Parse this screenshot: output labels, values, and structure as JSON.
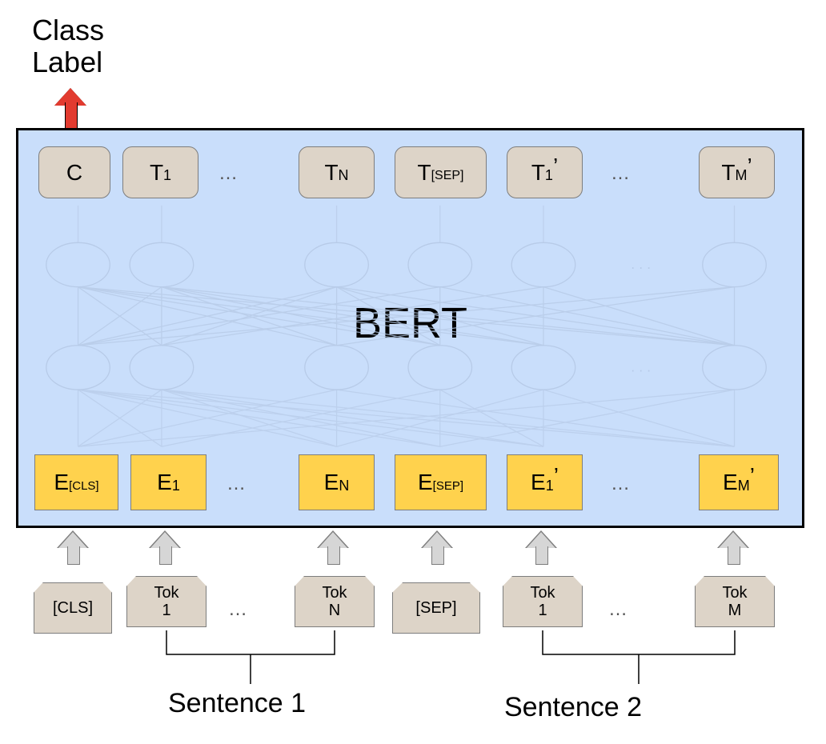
{
  "class_label_line1": "Class",
  "class_label_line2": "Label",
  "bert_title": "BERT",
  "top": {
    "c": "C",
    "t1": [
      "T",
      "1",
      ""
    ],
    "tn": [
      "T",
      "N",
      ""
    ],
    "tsep": [
      "T",
      "[SEP]",
      ""
    ],
    "t1p": [
      "T",
      "1",
      "’"
    ],
    "tmp": [
      "T",
      "M",
      "’"
    ]
  },
  "emb": {
    "ecls": [
      "E",
      "[CLS]",
      ""
    ],
    "e1": [
      "E",
      "1",
      ""
    ],
    "en": [
      "E",
      "N",
      ""
    ],
    "esep": [
      "E",
      "[SEP]",
      ""
    ],
    "e1p": [
      "E",
      "1",
      "’"
    ],
    "emp": [
      "E",
      "M",
      "’"
    ]
  },
  "tok": {
    "cls": "[CLS]",
    "t1": "Tok 1",
    "tn": "Tok N",
    "sep": "[SEP]",
    "t1p": "Tok 1",
    "tmp": "Tok M"
  },
  "dots": "…",
  "sentence1": "Sentence 1",
  "sentence2": "Sentence 2",
  "colors": {
    "bert_bg": "#c9defb",
    "embed_bg": "#ffd24d",
    "token_bg": "#ddd4c8",
    "arrow_red": "#e23b2f",
    "arrow_grey": "#d6d6d6"
  },
  "chart_data": {
    "type": "diagram",
    "description": "BERT sentence-pair classification input/output schematic",
    "output": "Class Label from C (CLS output vector)",
    "outputs": [
      "C",
      "T_1",
      "…",
      "T_N",
      "T_[SEP]",
      "T_1'",
      "…",
      "T_M'"
    ],
    "inputs": [
      "E_[CLS]",
      "E_1",
      "…",
      "E_N",
      "E_[SEP]",
      "E_1'",
      "…",
      "E_M'"
    ],
    "tokens": [
      "[CLS]",
      "Tok 1",
      "…",
      "Tok N",
      "[SEP]",
      "Tok 1",
      "…",
      "Tok M"
    ],
    "groups": [
      {
        "name": "Sentence 1",
        "tokens": [
          "Tok 1",
          "…",
          "Tok N"
        ]
      },
      {
        "name": "Sentence 2",
        "tokens": [
          "Tok 1",
          "…",
          "Tok M"
        ]
      }
    ]
  }
}
